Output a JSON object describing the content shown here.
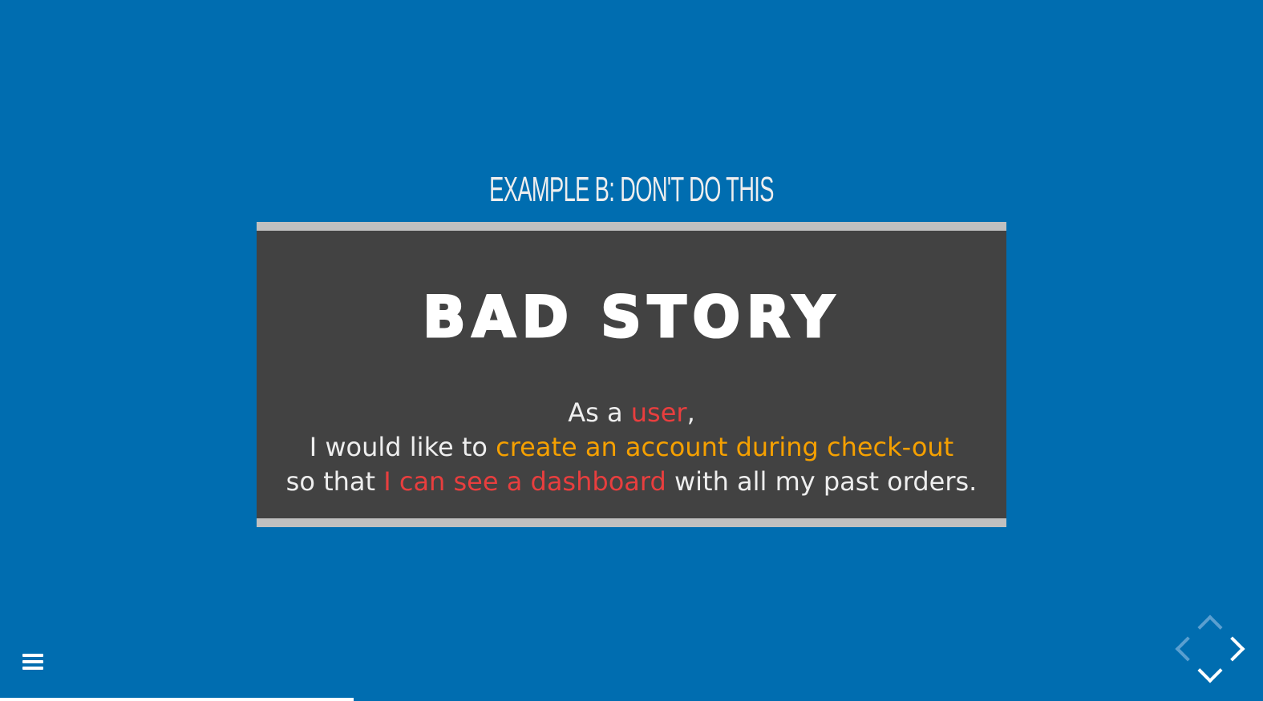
{
  "slide": {
    "title": "EXAMPLE B: DON'T DO THIS",
    "story_heading": "BAD STORY",
    "line1": {
      "prefix": "As a ",
      "highlight": "user",
      "suffix": ","
    },
    "line2": {
      "prefix": "I would like to ",
      "highlight": "create an account during check-out"
    },
    "line3": {
      "prefix": "so that ",
      "highlight": "I can see a dashboard",
      "suffix": " with all my past orders."
    }
  },
  "nav": {
    "menu_icon": "hamburger-icon",
    "controls": [
      "chevron-up-icon",
      "chevron-left-icon",
      "chevron-right-icon",
      "chevron-down-icon"
    ]
  },
  "progress": {
    "fraction": 0.28
  },
  "colors": {
    "background": "#006db0",
    "box": "#424242",
    "box_border": "#c0c0c0",
    "highlight_red": "#e83e3e",
    "highlight_orange": "#f5a000",
    "control_disabled": "#5a9fd0"
  }
}
